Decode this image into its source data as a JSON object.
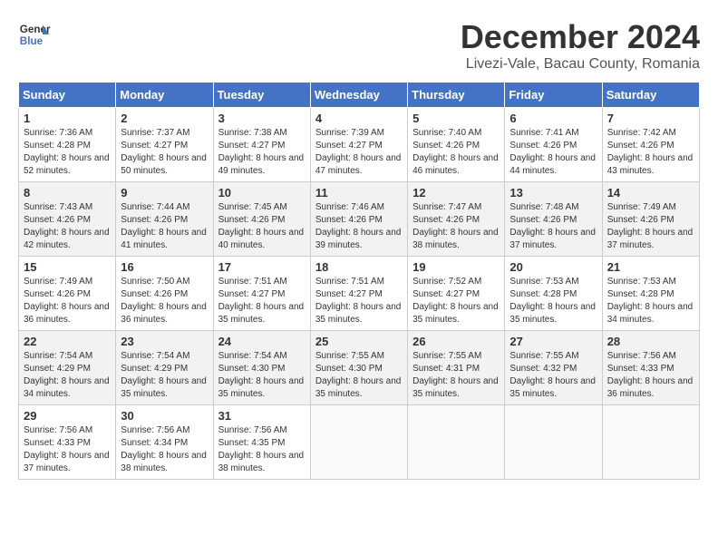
{
  "header": {
    "logo_line1": "General",
    "logo_line2": "Blue",
    "title": "December 2024",
    "subtitle": "Livezi-Vale, Bacau County, Romania"
  },
  "weekdays": [
    "Sunday",
    "Monday",
    "Tuesday",
    "Wednesday",
    "Thursday",
    "Friday",
    "Saturday"
  ],
  "weeks": [
    [
      {
        "day": "1",
        "sunrise": "7:36 AM",
        "sunset": "4:28 PM",
        "daylight": "8 hours and 52 minutes."
      },
      {
        "day": "2",
        "sunrise": "7:37 AM",
        "sunset": "4:27 PM",
        "daylight": "8 hours and 50 minutes."
      },
      {
        "day": "3",
        "sunrise": "7:38 AM",
        "sunset": "4:27 PM",
        "daylight": "8 hours and 49 minutes."
      },
      {
        "day": "4",
        "sunrise": "7:39 AM",
        "sunset": "4:27 PM",
        "daylight": "8 hours and 47 minutes."
      },
      {
        "day": "5",
        "sunrise": "7:40 AM",
        "sunset": "4:26 PM",
        "daylight": "8 hours and 46 minutes."
      },
      {
        "day": "6",
        "sunrise": "7:41 AM",
        "sunset": "4:26 PM",
        "daylight": "8 hours and 44 minutes."
      },
      {
        "day": "7",
        "sunrise": "7:42 AM",
        "sunset": "4:26 PM",
        "daylight": "8 hours and 43 minutes."
      }
    ],
    [
      {
        "day": "8",
        "sunrise": "7:43 AM",
        "sunset": "4:26 PM",
        "daylight": "8 hours and 42 minutes."
      },
      {
        "day": "9",
        "sunrise": "7:44 AM",
        "sunset": "4:26 PM",
        "daylight": "8 hours and 41 minutes."
      },
      {
        "day": "10",
        "sunrise": "7:45 AM",
        "sunset": "4:26 PM",
        "daylight": "8 hours and 40 minutes."
      },
      {
        "day": "11",
        "sunrise": "7:46 AM",
        "sunset": "4:26 PM",
        "daylight": "8 hours and 39 minutes."
      },
      {
        "day": "12",
        "sunrise": "7:47 AM",
        "sunset": "4:26 PM",
        "daylight": "8 hours and 38 minutes."
      },
      {
        "day": "13",
        "sunrise": "7:48 AM",
        "sunset": "4:26 PM",
        "daylight": "8 hours and 37 minutes."
      },
      {
        "day": "14",
        "sunrise": "7:49 AM",
        "sunset": "4:26 PM",
        "daylight": "8 hours and 37 minutes."
      }
    ],
    [
      {
        "day": "15",
        "sunrise": "7:49 AM",
        "sunset": "4:26 PM",
        "daylight": "8 hours and 36 minutes."
      },
      {
        "day": "16",
        "sunrise": "7:50 AM",
        "sunset": "4:26 PM",
        "daylight": "8 hours and 36 minutes."
      },
      {
        "day": "17",
        "sunrise": "7:51 AM",
        "sunset": "4:27 PM",
        "daylight": "8 hours and 35 minutes."
      },
      {
        "day": "18",
        "sunrise": "7:51 AM",
        "sunset": "4:27 PM",
        "daylight": "8 hours and 35 minutes."
      },
      {
        "day": "19",
        "sunrise": "7:52 AM",
        "sunset": "4:27 PM",
        "daylight": "8 hours and 35 minutes."
      },
      {
        "day": "20",
        "sunrise": "7:53 AM",
        "sunset": "4:28 PM",
        "daylight": "8 hours and 35 minutes."
      },
      {
        "day": "21",
        "sunrise": "7:53 AM",
        "sunset": "4:28 PM",
        "daylight": "8 hours and 34 minutes."
      }
    ],
    [
      {
        "day": "22",
        "sunrise": "7:54 AM",
        "sunset": "4:29 PM",
        "daylight": "8 hours and 34 minutes."
      },
      {
        "day": "23",
        "sunrise": "7:54 AM",
        "sunset": "4:29 PM",
        "daylight": "8 hours and 35 minutes."
      },
      {
        "day": "24",
        "sunrise": "7:54 AM",
        "sunset": "4:30 PM",
        "daylight": "8 hours and 35 minutes."
      },
      {
        "day": "25",
        "sunrise": "7:55 AM",
        "sunset": "4:30 PM",
        "daylight": "8 hours and 35 minutes."
      },
      {
        "day": "26",
        "sunrise": "7:55 AM",
        "sunset": "4:31 PM",
        "daylight": "8 hours and 35 minutes."
      },
      {
        "day": "27",
        "sunrise": "7:55 AM",
        "sunset": "4:32 PM",
        "daylight": "8 hours and 35 minutes."
      },
      {
        "day": "28",
        "sunrise": "7:56 AM",
        "sunset": "4:33 PM",
        "daylight": "8 hours and 36 minutes."
      }
    ],
    [
      {
        "day": "29",
        "sunrise": "7:56 AM",
        "sunset": "4:33 PM",
        "daylight": "8 hours and 37 minutes."
      },
      {
        "day": "30",
        "sunrise": "7:56 AM",
        "sunset": "4:34 PM",
        "daylight": "8 hours and 38 minutes."
      },
      {
        "day": "31",
        "sunrise": "7:56 AM",
        "sunset": "4:35 PM",
        "daylight": "8 hours and 38 minutes."
      },
      null,
      null,
      null,
      null
    ]
  ],
  "labels": {
    "sunrise": "Sunrise:",
    "sunset": "Sunset:",
    "daylight": "Daylight:"
  }
}
